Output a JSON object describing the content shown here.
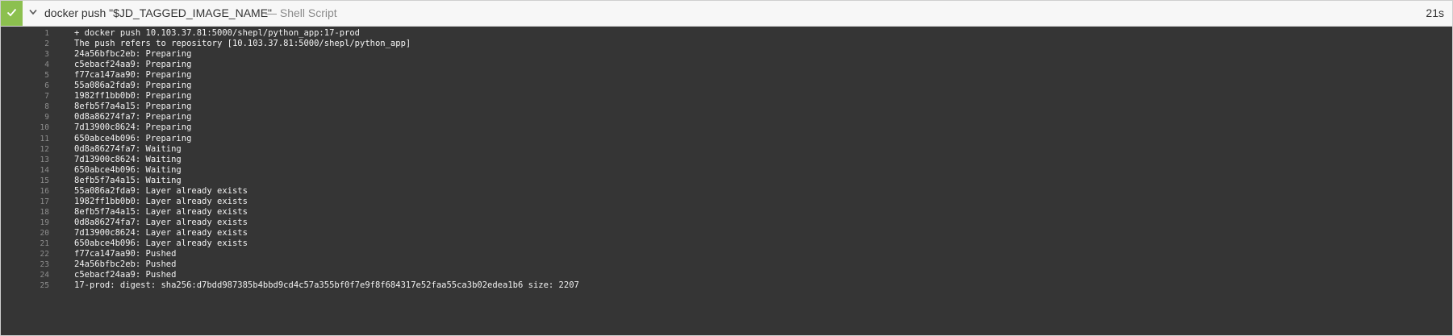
{
  "step": {
    "title": "docker push \"$JD_TAGGED_IMAGE_NAME\"",
    "type": "— Shell Script",
    "duration": "21s",
    "status_color": "#8cc04f",
    "status_icon": "check-icon",
    "toggle_icon": "chevron-down-icon"
  },
  "log": [
    {
      "n": "1",
      "text": "+ docker push 10.103.37.81:5000/shepl/python_app:17-prod"
    },
    {
      "n": "2",
      "text": "The push refers to repository [10.103.37.81:5000/shepl/python_app]"
    },
    {
      "n": "3",
      "text": "24a56bfbc2eb: Preparing"
    },
    {
      "n": "4",
      "text": "c5ebacf24aa9: Preparing"
    },
    {
      "n": "5",
      "text": "f77ca147aa90: Preparing"
    },
    {
      "n": "6",
      "text": "55a086a2fda9: Preparing"
    },
    {
      "n": "7",
      "text": "1982ff1bb0b0: Preparing"
    },
    {
      "n": "8",
      "text": "8efb5f7a4a15: Preparing"
    },
    {
      "n": "9",
      "text": "0d8a86274fa7: Preparing"
    },
    {
      "n": "10",
      "text": "7d13900c8624: Preparing"
    },
    {
      "n": "11",
      "text": "650abce4b096: Preparing"
    },
    {
      "n": "12",
      "text": "0d8a86274fa7: Waiting"
    },
    {
      "n": "13",
      "text": "7d13900c8624: Waiting"
    },
    {
      "n": "14",
      "text": "650abce4b096: Waiting"
    },
    {
      "n": "15",
      "text": "8efb5f7a4a15: Waiting"
    },
    {
      "n": "16",
      "text": "55a086a2fda9: Layer already exists"
    },
    {
      "n": "17",
      "text": "1982ff1bb0b0: Layer already exists"
    },
    {
      "n": "18",
      "text": "8efb5f7a4a15: Layer already exists"
    },
    {
      "n": "19",
      "text": "0d8a86274fa7: Layer already exists"
    },
    {
      "n": "20",
      "text": "7d13900c8624: Layer already exists"
    },
    {
      "n": "21",
      "text": "650abce4b096: Layer already exists"
    },
    {
      "n": "22",
      "text": "f77ca147aa90: Pushed"
    },
    {
      "n": "23",
      "text": "24a56bfbc2eb: Pushed"
    },
    {
      "n": "24",
      "text": "c5ebacf24aa9: Pushed"
    },
    {
      "n": "25",
      "text": "17-prod: digest: sha256:d7bdd987385b4bbd9cd4c57a355bf0f7e9f8f684317e52faa55ca3b02edea1b6 size: 2207"
    }
  ]
}
